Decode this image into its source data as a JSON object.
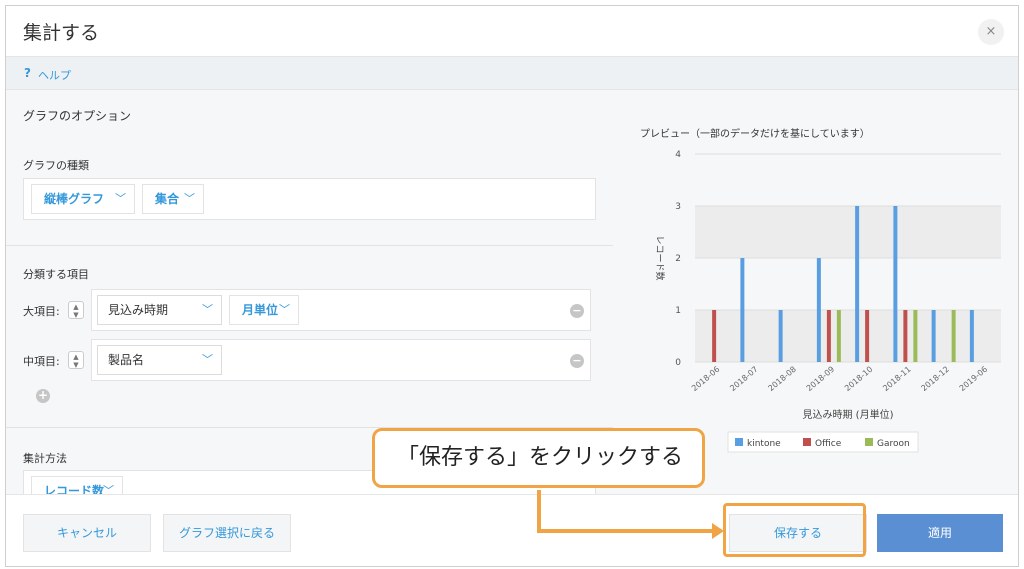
{
  "dialog": {
    "title": "集計する",
    "close_label": "×"
  },
  "help": {
    "icon_label": "?",
    "label": "ヘルプ"
  },
  "options": {
    "section_title": "グラフのオプション",
    "graph_type_label": "グラフの種類",
    "graph_type_value": "縦棒グラフ",
    "graph_mode_value": "集合",
    "classify_title": "分類する項目",
    "major_label": "大項目:",
    "major_field": "見込み時期",
    "major_unit": "月単位",
    "minor_label": "中項目:",
    "minor_field": "製品名",
    "aggregate_title": "集計方法",
    "aggregate_value": "レコード数"
  },
  "preview": {
    "title": "プレビュー（一部のデータだけを基にしています）"
  },
  "chart_data": {
    "type": "bar",
    "ylabel": "レコード数",
    "xlabel": "見込み時期 (月単位)",
    "ylim": [
      0,
      4
    ],
    "yticks": [
      "0",
      "1",
      "2",
      "3",
      "4"
    ],
    "categories": [
      "2018-06",
      "2018-07",
      "2018-08",
      "2018-09",
      "2018-10",
      "2018-11",
      "2018-12",
      "2019-06"
    ],
    "series": [
      {
        "name": "kintone",
        "color": "#5a9ee2",
        "values": [
          0,
          2,
          1,
          2,
          3,
          3,
          1,
          1
        ]
      },
      {
        "name": "Office",
        "color": "#c0504d",
        "values": [
          1,
          0,
          0,
          1,
          1,
          1,
          0,
          0
        ]
      },
      {
        "name": "Garoon",
        "color": "#9bbb59",
        "values": [
          0,
          0,
          0,
          1,
          0,
          1,
          1,
          0
        ]
      }
    ],
    "legend": "bottom"
  },
  "footer": {
    "cancel_label": "キャンセル",
    "back_label": "グラフ選択に戻る",
    "save_label": "保存する",
    "apply_label": "適用"
  },
  "callout": {
    "text": "「保存する」をクリックする",
    "accent_color": "#f0a446"
  }
}
